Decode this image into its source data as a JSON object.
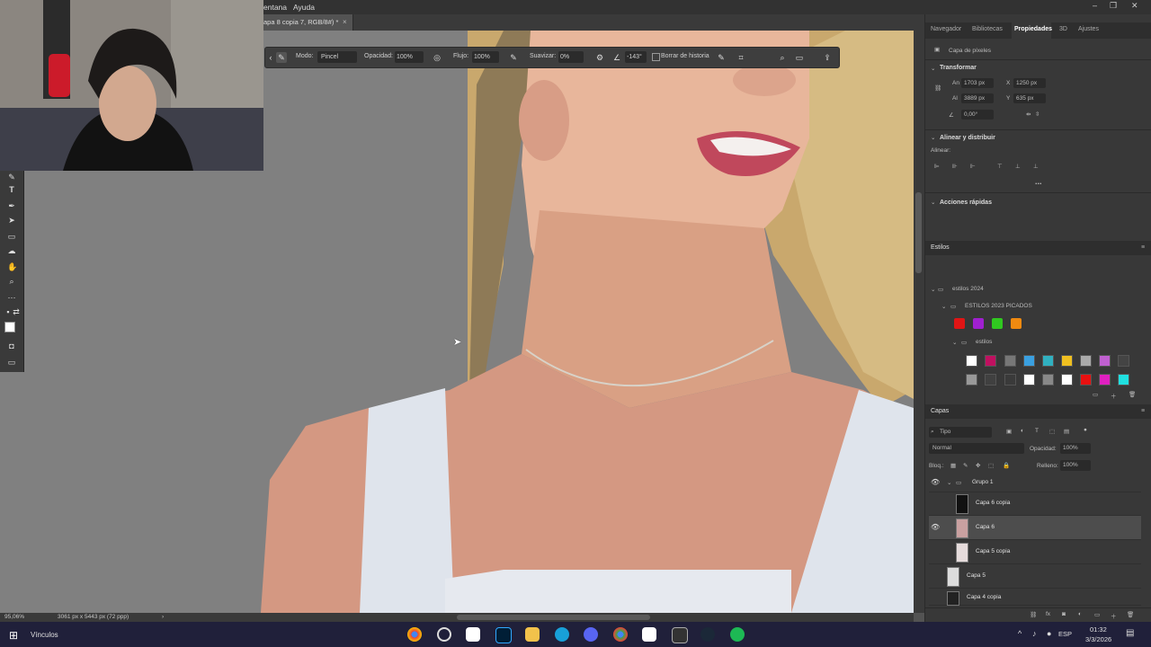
{
  "menubar": {
    "items": [
      "entana",
      "Ayuda"
    ]
  },
  "document": {
    "tab_title": "apa 8 copia 7, RGB/8#) *",
    "close_glyph": "×"
  },
  "options_bar": {
    "mode_label": "Modo:",
    "mode_value": "Pincel",
    "opacity_label": "Opacidad:",
    "opacity_value": "100%",
    "flow_label": "Flujo:",
    "flow_value": "100%",
    "smoothing_label": "Suavizar:",
    "smoothing_value": "0%",
    "angle_value": "-143°",
    "history_label": "Borrar de historia"
  },
  "status": {
    "zoom": "95,06%",
    "doc_info": "3061 px x 5443 px (72 ppp)"
  },
  "panel_tabs": [
    "Navegador",
    "Bibliotecas",
    "Propiedades",
    "3D",
    "Ajustes"
  ],
  "properties": {
    "layer_kind": "Capa de píxeles",
    "transform_title": "Transformar",
    "w_label": "An",
    "w_value": "1703 px",
    "x_label": "X",
    "x_value": "1250 px",
    "h_label": "Al",
    "h_value": "3889 px",
    "y_label": "Y",
    "y_value": "635 px",
    "angle_value": "0,00°",
    "align_title": "Alinear y distribuir",
    "align_label": "Alinear:",
    "more_glyph": "...",
    "quick_actions_title": "Acciones rápidas"
  },
  "styles": {
    "tab": "Estilos",
    "folder_1": "estilos 2024",
    "folder_2": "ESTILOS 2023 PICADOS",
    "folder_3": "estilos",
    "swatch_colors": [
      "#e01515",
      "#a020d0",
      "#30c820",
      "#f08a10"
    ]
  },
  "layers": {
    "tab": "Capas",
    "filter_value": "Tipo",
    "blend_value": "Normal",
    "opacity_label": "Opacidad:",
    "opacity_value": "100%",
    "lock_label": "Bloq.:",
    "fill_label": "Relleno:",
    "fill_value": "100%",
    "items": [
      {
        "name": "Grupo 1",
        "visible": true
      },
      {
        "name": "Capa 6 copia",
        "visible": false
      },
      {
        "name": "Capa 6",
        "visible": true
      },
      {
        "name": "Capa 5 copia",
        "visible": false
      },
      {
        "name": "Capa 5",
        "visible": false
      },
      {
        "name": "Capa 4 copia",
        "visible": false
      }
    ]
  },
  "taskbar": {
    "links_label": "Vínculos",
    "lang": "ESP",
    "time": "01:32",
    "date": "3/3/2026"
  }
}
